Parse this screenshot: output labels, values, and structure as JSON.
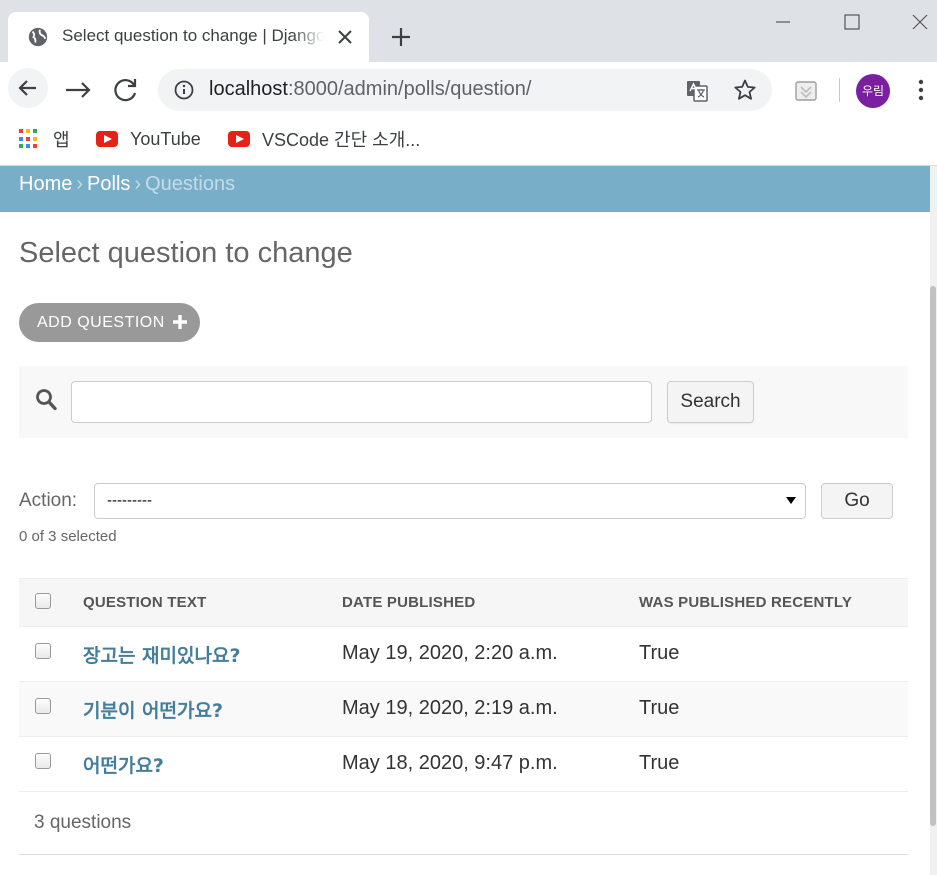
{
  "browser": {
    "tab_title": "Select question to change | Django site admin",
    "url_host": "localhost",
    "url_path": ":8000/admin/polls/question/",
    "avatar_label": "우림",
    "bookmarks": [
      {
        "label": "앱",
        "icon": "apps-grid-icon"
      },
      {
        "label": "YouTube",
        "icon": "youtube-icon"
      },
      {
        "label": "VSCode 간단 소개...",
        "icon": "youtube-icon"
      }
    ]
  },
  "breadcrumbs": {
    "home": "Home",
    "app": "Polls",
    "current": "Questions",
    "separator": "›"
  },
  "page": {
    "title": "Select question to change",
    "add_button": "ADD QUESTION",
    "search_button": "Search",
    "search_value": "",
    "action_label": "Action:",
    "action_selected": "---------",
    "go_button": "Go",
    "selected_count": "0 of 3 selected",
    "paginator": "3 questions"
  },
  "table": {
    "columns": [
      "QUESTION TEXT",
      "DATE PUBLISHED",
      "WAS PUBLISHED RECENTLY"
    ],
    "rows": [
      {
        "question": "장고는 재미있나요?",
        "date": "May 19, 2020, 2:20 a.m.",
        "recent": "True"
      },
      {
        "question": "기분이 어떤가요?",
        "date": "May 19, 2020, 2:19 a.m.",
        "recent": "True"
      },
      {
        "question": "어떤가요?",
        "date": "May 18, 2020, 9:47 p.m.",
        "recent": "True"
      }
    ]
  },
  "colors": {
    "breadcrumb_bg": "#79aec8",
    "link": "#447e9b",
    "add_button_bg": "#999999",
    "avatar_bg": "#7b1fa2",
    "youtube_red": "#e62117"
  }
}
